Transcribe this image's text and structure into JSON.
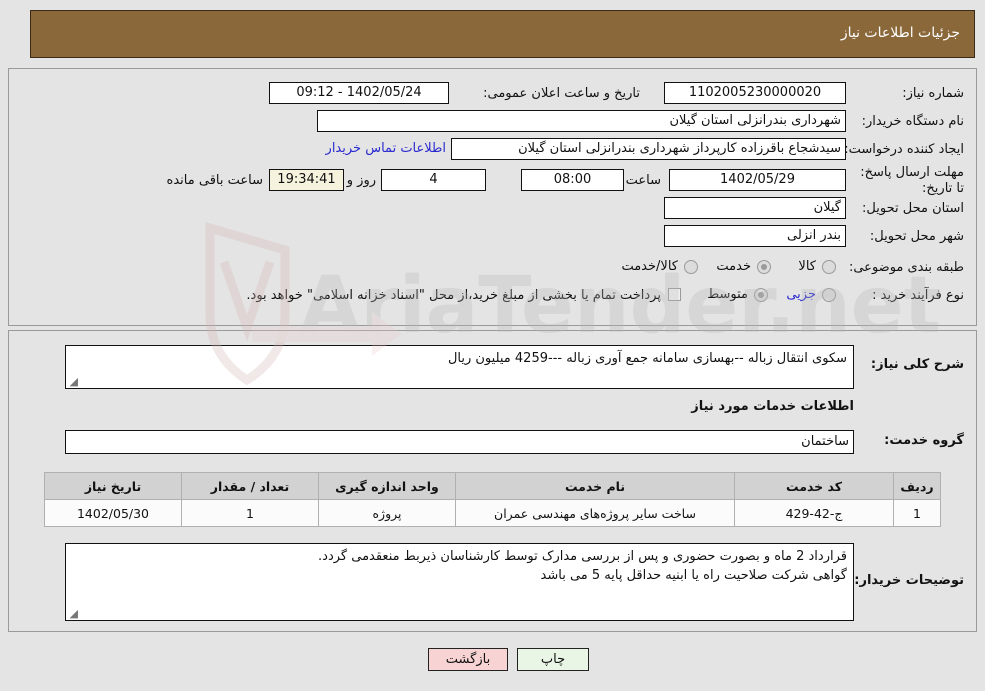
{
  "header": {
    "title": "جزئیات اطلاعات نیاز"
  },
  "info": {
    "need_number_label": "شماره نیاز:",
    "need_number_value": "1102005230000020",
    "announce_label": "تاریخ و ساعت اعلان عمومی:",
    "announce_value": "1402/05/24 - 09:12",
    "buyer_org_label": "نام دستگاه خریدار:",
    "buyer_org_value": "شهرداری بندرانزلی استان گیلان",
    "requester_label": "ایجاد کننده درخواست:",
    "requester_value": "سیدشجاع باقرزاده کارپرداز شهرداری بندرانزلی استان گیلان",
    "contact_link": "اطلاعات تماس خریدار",
    "deadline_label": "مهلت ارسال پاسخ: تا تاریخ:",
    "deadline_date": "1402/05/29",
    "hour_label": "ساعت",
    "deadline_time": "08:00",
    "days_value": "4",
    "days_label": "روز و",
    "countdown_value": "19:34:41",
    "remaining_label": "ساعت باقی مانده",
    "province_label": "استان محل تحویل:",
    "province_value": "گیلان",
    "city_label": "شهر محل تحویل:",
    "city_value": "بندر انزلی",
    "category_label": "طبقه بندی موضوعی:",
    "category_options": [
      "کالا",
      "خدمت",
      "کالا/خدمت"
    ],
    "process_label": "نوع فرآیند خرید :",
    "process_options": [
      "جزیی",
      "متوسط"
    ],
    "treasury_note": "پرداخت تمام یا بخشی از مبلغ خرید،از محل \"اسناد خزانه اسلامی\" خواهد بود."
  },
  "description": {
    "label": "شرح کلی نیاز:",
    "value": "سکوی انتقال زباله --بهسازی سامانه جمع آوری زباله ---4259 میلیون ریال"
  },
  "services": {
    "section_title": "اطلاعات خدمات مورد نیاز",
    "group_label": "گروه خدمت:",
    "group_value": "ساختمان",
    "columns": [
      "ردیف",
      "کد خدمت",
      "نام خدمت",
      "واحد اندازه گیری",
      "تعداد / مقدار",
      "تاریخ نیاز"
    ],
    "rows": [
      {
        "row": "1",
        "code": "ج-42-429",
        "name": "ساخت سایر پروژه‌های مهندسی عمران",
        "unit": "پروژه",
        "qty": "1",
        "date": "1402/05/30"
      }
    ]
  },
  "notes": {
    "label": "توضیحات خریدار:",
    "line1": "قرارداد 2 ماه و بصورت حضوری و پس از بررسی مدارک توسط کارشناسان ذیربط منعقدمی گردد.",
    "line2": "گواهی شرکت  صلاحیت راه یا ابنیه حداقل پایه 5  می باشد"
  },
  "footer": {
    "print_label": "چاپ",
    "back_label": "بازگشت"
  },
  "watermark": {
    "text": "AriaTender.net"
  },
  "colors": {
    "header_bg": "#8b6839",
    "page_bg": "#e4e4e4",
    "link": "#2a2ad0",
    "print_btn": "#e9f5e5",
    "back_btn": "#f8d3d3",
    "countdown_bg": "#f5f3de"
  }
}
